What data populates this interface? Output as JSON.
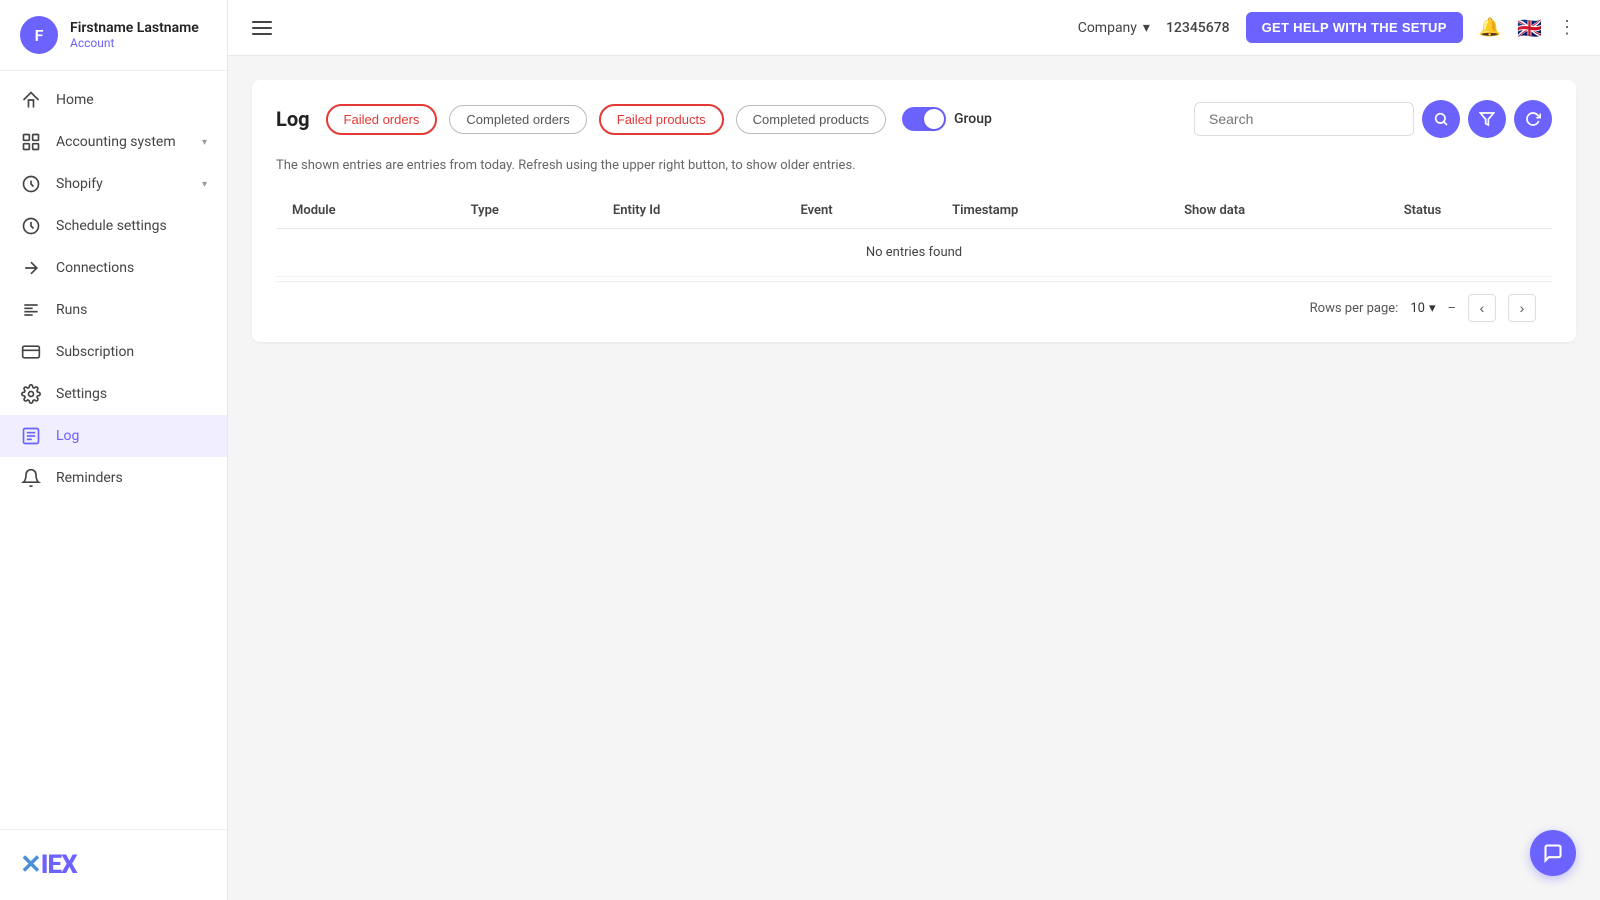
{
  "sidebar": {
    "user": {
      "initials": "F",
      "name": "Firstname Lastname",
      "account_label": "Account"
    },
    "nav_items": [
      {
        "id": "home",
        "label": "Home",
        "icon": "home"
      },
      {
        "id": "accounting",
        "label": "Accounting system",
        "icon": "accounting",
        "has_chevron": true
      },
      {
        "id": "shopify",
        "label": "Shopify",
        "icon": "shopify",
        "has_chevron": true
      },
      {
        "id": "schedule",
        "label": "Schedule settings",
        "icon": "schedule"
      },
      {
        "id": "connections",
        "label": "Connections",
        "icon": "connections"
      },
      {
        "id": "runs",
        "label": "Runs",
        "icon": "runs"
      },
      {
        "id": "subscription",
        "label": "Subscription",
        "icon": "subscription"
      },
      {
        "id": "settings",
        "label": "Settings",
        "icon": "settings"
      },
      {
        "id": "log",
        "label": "Log",
        "icon": "log",
        "active": true
      },
      {
        "id": "reminders",
        "label": "Reminders",
        "icon": "reminders"
      }
    ],
    "logo": "✕IEX"
  },
  "topbar": {
    "company_label": "Company",
    "company_id": "12345678",
    "get_help_label": "GET HELP WITH THE SETUP",
    "flag": "🇬🇧"
  },
  "page": {
    "title": "Log",
    "filters": [
      {
        "id": "failed_orders",
        "label": "Failed orders",
        "active": true,
        "style": "active-red"
      },
      {
        "id": "completed_orders",
        "label": "Completed orders",
        "active": false,
        "style": "inactive"
      },
      {
        "id": "failed_products",
        "label": "Failed products",
        "active": true,
        "style": "active-red"
      },
      {
        "id": "completed_products",
        "label": "Completed products",
        "active": false,
        "style": "inactive"
      }
    ],
    "group_label": "Group",
    "group_enabled": true,
    "search_placeholder": "Search",
    "info_text": "The shown entries are entries from today. Refresh using the upper right button, to show older entries.",
    "table": {
      "columns": [
        "Module",
        "Type",
        "Entity Id",
        "Event",
        "Timestamp",
        "Show data",
        "Status"
      ],
      "empty_message": "No entries found"
    },
    "pagination": {
      "rows_per_page_label": "Rows per page:",
      "rows_per_page_value": "10",
      "page_range": "–"
    }
  }
}
